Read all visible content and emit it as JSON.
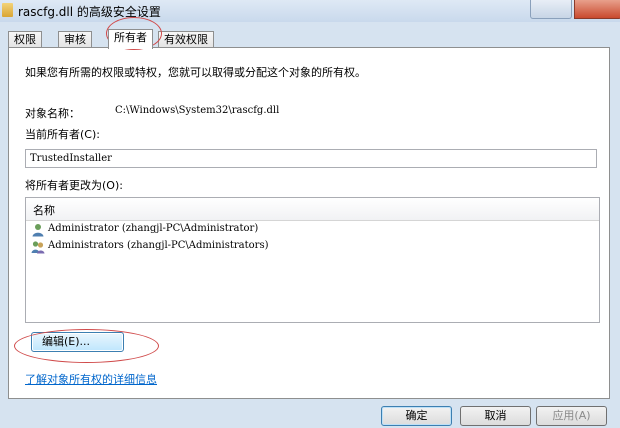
{
  "window": {
    "title": "rascfg.dll 的高级安全设置"
  },
  "tabs": [
    {
      "label": "权限",
      "active": false
    },
    {
      "label": "审核",
      "active": false
    },
    {
      "label": "所有者",
      "active": true
    },
    {
      "label": "有效权限",
      "active": false
    }
  ],
  "owner_tab": {
    "intro": "如果您有所需的权限或特权，您就可以取得或分配这个对象的所有权。",
    "object_name_label": "对象名称：",
    "object_name_value": "C:\\Windows\\System32\\rascfg.dll",
    "current_owner_label": "当前所有者(C):",
    "current_owner_value": "TrustedInstaller",
    "change_owner_label": "将所有者更改为(O):",
    "list_header": "名称",
    "owner_candidates": [
      {
        "name": "Administrator (zhangjl-PC\\Administrator)",
        "icon": "user-icon"
      },
      {
        "name": "Administrators (zhangjl-PC\\Administrators)",
        "icon": "group-icon"
      }
    ],
    "edit_button": "编辑(E)...",
    "learn_more_link": "了解对象所有权的详细信息"
  },
  "footer": {
    "ok": "确定",
    "cancel": "取消",
    "apply": "应用(A)"
  },
  "colors": {
    "window_bg": "#d6e3f0",
    "annotation": "#d04a4a",
    "link": "#0066cc"
  }
}
